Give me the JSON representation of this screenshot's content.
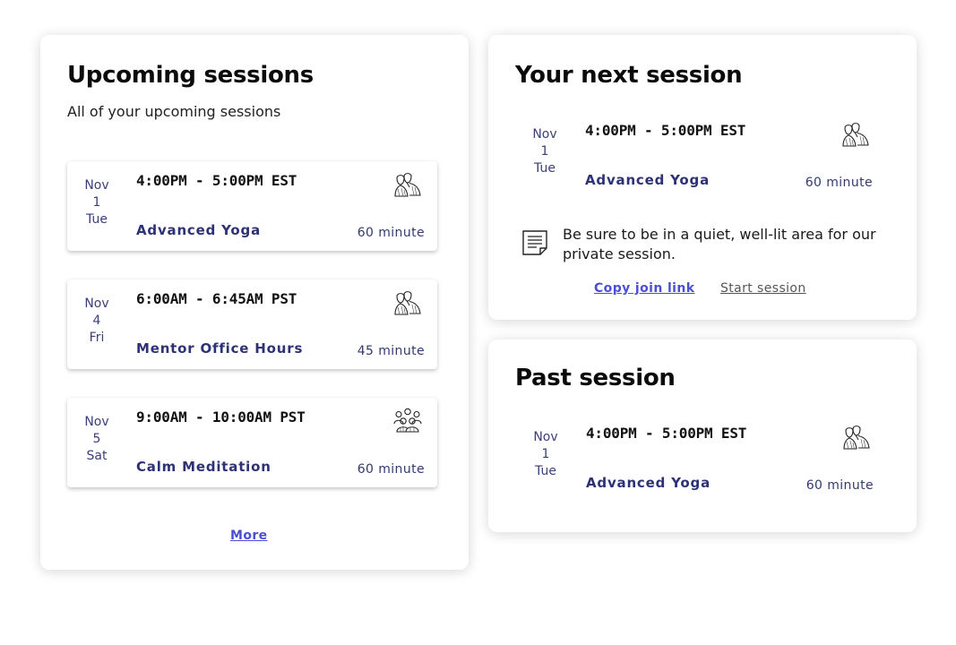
{
  "upcoming": {
    "title": "Upcoming sessions",
    "subtitle": "All of your upcoming sessions",
    "sessions": [
      {
        "month": "Nov",
        "day": "1",
        "weekday": "Tue",
        "time": "4:00PM - 5:00PM EST",
        "name": "Advanced Yoga",
        "duration": "60 minute",
        "icon": "private-session-icon"
      },
      {
        "month": "Nov",
        "day": "4",
        "weekday": "Fri",
        "time": "6:00AM - 6:45AM PST",
        "name": "Mentor Office Hours",
        "duration": "45 minute",
        "icon": "private-session-icon"
      },
      {
        "month": "Nov",
        "day": "5",
        "weekday": "Sat",
        "time": "9:00AM - 10:00AM PST",
        "name": "Calm Meditation",
        "duration": "60 minute",
        "icon": "group-session-icon"
      }
    ],
    "more_label": "More"
  },
  "next": {
    "title": "Your next session",
    "session": {
      "month": "Nov",
      "day": "1",
      "weekday": "Tue",
      "time": "4:00PM - 5:00PM EST",
      "name": "Advanced Yoga",
      "duration": "60 minute",
      "icon": "private-session-icon"
    },
    "note": "Be sure to be in a quiet, well-lit area for our private session.",
    "note_icon": "document-icon",
    "copy_link_label": "Copy join link",
    "start_label": "Start session"
  },
  "past": {
    "title": "Past session",
    "session": {
      "month": "Nov",
      "day": "1",
      "weekday": "Tue",
      "time": "4:00PM - 5:00PM EST",
      "name": "Advanced Yoga",
      "duration": "60 minute",
      "icon": "private-session-icon"
    }
  },
  "colors": {
    "session_name": "#2e3175",
    "link_primary": "#4b4fd6",
    "date_text": "#3a3f79"
  }
}
